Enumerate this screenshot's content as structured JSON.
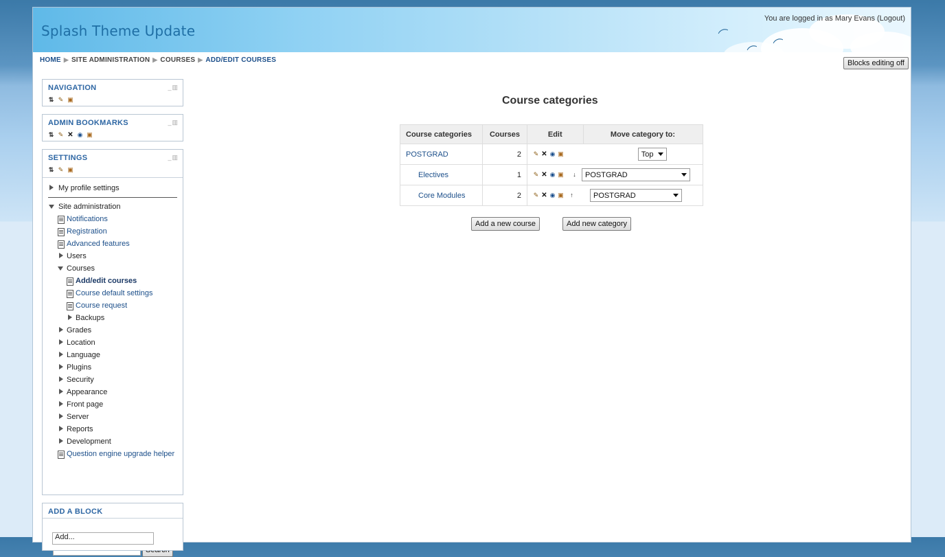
{
  "header": {
    "site_title": "Splash Theme Update",
    "login_prefix": "You are logged in as",
    "user_name": "Mary Evans",
    "logout_label": "(Logout)"
  },
  "breadcrumb": [
    "HOME",
    "SITE ADMINISTRATION",
    "COURSES",
    "ADD/EDIT COURSES"
  ],
  "blocks_editing_button": "Blocks editing off",
  "blocks": {
    "navigation": {
      "title": "NAVIGATION"
    },
    "admin_bookmarks": {
      "title": "ADMIN BOOKMARKS"
    },
    "settings": {
      "title": "SETTINGS"
    },
    "add_block": {
      "title": "ADD A BLOCK",
      "select_value": "Add..."
    }
  },
  "settings_tree": {
    "my_profile": "My profile settings",
    "site_admin": "Site administration",
    "notifications": "Notifications",
    "registration": "Registration",
    "advanced_features": "Advanced features",
    "users": "Users",
    "courses": "Courses",
    "add_edit_courses": "Add/edit courses",
    "course_default_settings": "Course default settings",
    "course_request": "Course request",
    "backups": "Backups",
    "grades": "Grades",
    "location": "Location",
    "language": "Language",
    "plugins": "Plugins",
    "security": "Security",
    "appearance": "Appearance",
    "front_page": "Front page",
    "server": "Server",
    "reports": "Reports",
    "development": "Development",
    "question_engine": "Question engine upgrade helper"
  },
  "search": {
    "button": "Search",
    "value": ""
  },
  "main": {
    "title": "Course categories",
    "columns": [
      "Course categories",
      "Courses",
      "Edit",
      "Move category to:"
    ],
    "rows": [
      {
        "name": "POSTGRAD",
        "courses": "2",
        "move_to": "Top"
      },
      {
        "name": "Electives",
        "courses": "1",
        "move_to": "POSTGRAD"
      },
      {
        "name": "Core Modules",
        "courses": "2",
        "move_to": "POSTGRAD"
      }
    ],
    "add_course_button": "Add a new course",
    "add_category_button": "Add new category"
  }
}
